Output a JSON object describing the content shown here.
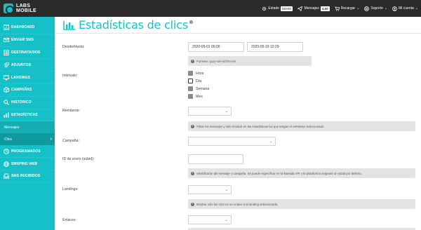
{
  "logo": {
    "line1": "LABS",
    "line2": "MOBILE"
  },
  "sidebar": {
    "items": [
      {
        "label": "DASHBOARD",
        "icon": "dashboard-icon"
      },
      {
        "label": "ENVIAR SMS",
        "icon": "envelope-icon"
      },
      {
        "label": "DESTINATARIOS",
        "icon": "contacts-icon"
      },
      {
        "label": "ADJUNTOS",
        "icon": "paperclip-icon"
      },
      {
        "label": "LANDINGS",
        "icon": "monitor-icon"
      },
      {
        "label": "CAMPAÑAS",
        "icon": "box-icon"
      },
      {
        "label": "HISTÓRICO",
        "icon": "search-icon"
      },
      {
        "label": "ESTADÍSTICAS",
        "icon": "bar-chart-icon"
      }
    ],
    "sub_items": [
      {
        "label": "Mensajes"
      },
      {
        "label": "Clics",
        "chevron": "›"
      }
    ],
    "items_after": [
      {
        "label": "PROGRAMADOS",
        "icon": "clock-icon"
      },
      {
        "label": "SMSPING WEB",
        "icon": "globe-icon"
      },
      {
        "label": "SMS RECIBIDOS",
        "icon": "inbox-icon"
      }
    ]
  },
  "topbar": {
    "estado_label": "Estado",
    "estado_badge": "DEMO",
    "mensajes_label": "Mensajes",
    "mensajes_badge": "4,00",
    "recargar_label": "Recargar",
    "soporte_label": "Soporte",
    "cuenta_label": "Mi cuenta"
  },
  "page": {
    "title": "Estadísticas de clics"
  },
  "form": {
    "desde_label": "Desde/Hasta:",
    "desde_value": "2020-05-01 00:00",
    "hasta_value": "2020-05-19 12:29",
    "formato_help": "Formato: yyyy-mm-dd hh:mm",
    "intervalo_label": "Intervalo:",
    "intervalo_options": [
      "Hora",
      "Día",
      "Semana",
      "Mes"
    ],
    "intervalo_selected": "Día",
    "remitente_label": "Remitente:",
    "remitente_help": "Filtrar los mensajes y sólo mostrar en las estadísticas los que tengan el remitente seleccionado.",
    "campana_label": "Campaña:",
    "id_envio_label": "ID de envío (subid):",
    "id_envio_help": "Identificador del mensaje o campaña. Se puede especificar en la llamada API o la plataforma asignará un subid por defecto.",
    "landings_label": "Landings:",
    "landings_help": "Mostrar sólo los clics en un enlace a la landing seleccionada.",
    "enlaces_label": "Enlaces:"
  },
  "colors": {
    "accent": "#16c0c8",
    "topbar": "#2b2b2b",
    "help_bg": "#e3e3e3"
  }
}
